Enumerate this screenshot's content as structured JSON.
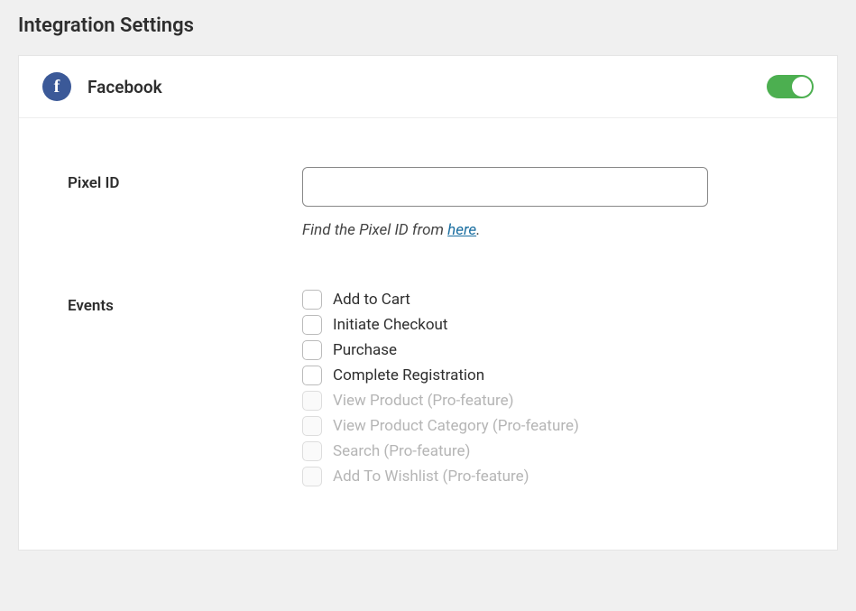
{
  "page_title": "Integration Settings",
  "integration": {
    "name": "Facebook",
    "icon_letter": "f",
    "enabled": true
  },
  "pixel": {
    "label": "Pixel ID",
    "value": "",
    "hint_prefix": "Find the Pixel ID from ",
    "hint_link_text": "here",
    "hint_suffix": "."
  },
  "events": {
    "label": "Events",
    "items": [
      {
        "label": "Add to Cart",
        "disabled": false
      },
      {
        "label": "Initiate Checkout",
        "disabled": false
      },
      {
        "label": "Purchase",
        "disabled": false
      },
      {
        "label": "Complete Registration",
        "disabled": false
      },
      {
        "label": "View Product (Pro-feature)",
        "disabled": true
      },
      {
        "label": "View Product Category (Pro-feature)",
        "disabled": true
      },
      {
        "label": "Search (Pro-feature)",
        "disabled": true
      },
      {
        "label": "Add To Wishlist (Pro-feature)",
        "disabled": true
      }
    ]
  }
}
